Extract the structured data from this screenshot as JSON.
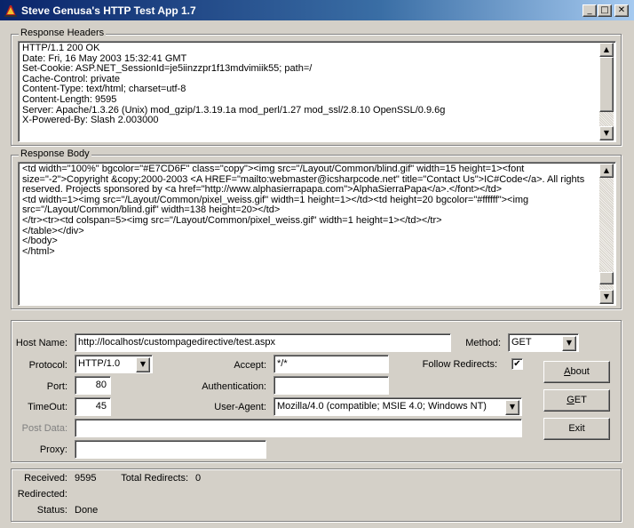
{
  "window": {
    "title": "Steve Genusa's  HTTP Test App 1.7",
    "controls": {
      "minimize": "_",
      "maximize": "□",
      "close": "✕"
    }
  },
  "response_headers": {
    "label": "Response Headers",
    "text": "HTTP/1.1 200 OK\nDate: Fri, 16 May 2003 15:32:41 GMT\nSet-Cookie: ASP.NET_SessionId=je5iinzzpr1f13mdvimiik55; path=/\nCache-Control: private\nContent-Type: text/html; charset=utf-8\nContent-Length: 9595\nServer: Apache/1.3.26 (Unix) mod_gzip/1.3.19.1a mod_perl/1.27 mod_ssl/2.8.10 OpenSSL/0.9.6g\nX-Powered-By: Slash 2.003000"
  },
  "response_body": {
    "label": "Response Body",
    "text": "<td width=\"100%\" bgcolor=\"#E7CD6F\" class=\"copy\"><img src=\"/Layout/Common/blind.gif\" width=15 height=1><font size=\"-2\">Copyright &copy;2000-2003 <A HREF=\"mailto:webmaster@icsharpcode.net\" title=\"Contact Us\">IC#Code</a>. All rights reserved. Projects sponsored by <a href=\"http://www.alphasierrapapa.com\">AlphaSierraPapa</a>.</font></td>\n<td width=1><img src=\"/Layout/Common/pixel_weiss.gif\" width=1 height=1></td><td height=20 bgcolor=\"#ffffff\"><img src=\"/Layout/Common/blind.gif\" width=138 height=20></td>\n</tr><tr><td colspan=5><img src=\"/Layout/Common/pixel_weiss.gif\" width=1 height=1></td></tr>\n</table></div>\n</body>\n</html>"
  },
  "scroll": {
    "up": "▲",
    "down": "▼"
  },
  "form": {
    "host_label": "Host Name:",
    "host_value": "http://localhost/custompagedirective/test.aspx",
    "method_label": "Method:",
    "method_value": "GET",
    "protocol_label": "Protocol:",
    "protocol_value": "HTTP/1.0",
    "accept_label": "Accept:",
    "accept_value": "*/*",
    "follow_label": "Follow Redirects:",
    "follow_checked": "✔",
    "port_label": "Port:",
    "port_value": "80",
    "auth_label": "Authentication:",
    "auth_value": "",
    "timeout_label": "TimeOut:",
    "timeout_value": "45",
    "useragent_label": "User-Agent:",
    "useragent_value": "Mozilla/4.0 (compatible; MSIE 4.0; Windows NT)",
    "postdata_label": "Post Data:",
    "postdata_value": "",
    "proxy_label": "Proxy:",
    "proxy_value": "",
    "combo_arrow": "▼"
  },
  "buttons": {
    "about_prefix": "",
    "about_hotkey": "A",
    "about_rest": "bout",
    "get_prefix": "",
    "get_hotkey": "G",
    "get_rest": "ET",
    "exit": "Exit"
  },
  "status": {
    "received_label": "Received:",
    "received_value": "9595",
    "total_redirects_label": "Total Redirects:",
    "total_redirects_value": "0",
    "redirected_label": "Redirected:",
    "redirected_value": "",
    "status_label": "Status:",
    "status_value": "Done"
  },
  "colors": {
    "titlebar_start": "#0a246a",
    "titlebar_end": "#a6caf0",
    "face": "#d4d0c8"
  }
}
